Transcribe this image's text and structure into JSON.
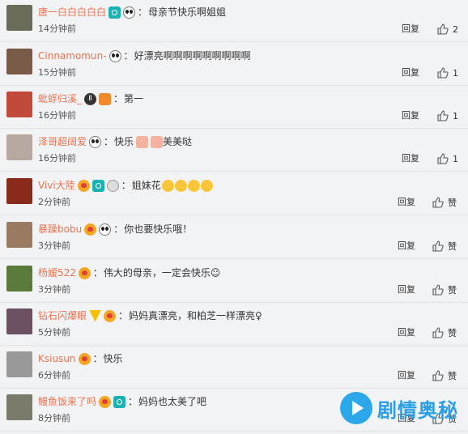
{
  "actions": {
    "reply_label": "回复",
    "like_prefix": "赞"
  },
  "comments": [
    {
      "user": "唐一白白白白白",
      "separator": "：",
      "text": "母亲节快乐啊姐姐",
      "time": "14分钟前",
      "likes": "2",
      "avatar_color": "#6b6b5a",
      "badges": [
        "teal",
        "panda"
      ],
      "emojis": 0
    },
    {
      "user": "Cinnamomun-",
      "separator": "：",
      "text": "好漂亮啊啊啊啊啊啊啊啊啊",
      "time": "15分钟前",
      "likes": "1",
      "avatar_color": "#7a5b4a",
      "badges": [
        "panda"
      ],
      "emojis": 0
    },
    {
      "user": "蚍蜉归溪_",
      "separator": "：",
      "text": "第一",
      "time": "16分钟前",
      "likes": "1",
      "avatar_color": "#c24a3a",
      "badges": [
        "dark",
        "orange"
      ],
      "emojis": 0
    },
    {
      "user": "泽哥超阔爱",
      "separator": "：",
      "text": "快乐",
      "text2": "美美哒",
      "time": "16分钟前",
      "likes": "1",
      "avatar_color": "#b8a9a0",
      "badges": [
        "panda"
      ],
      "emojis": 0,
      "mid_badges": [
        "pink",
        "pink"
      ]
    },
    {
      "user": "Vivi大陸",
      "separator": "：",
      "text": "姐妹花",
      "time": "2分钟前",
      "likes": "赞",
      "avatar_color": "#8a2a1a",
      "badges": [
        "heart",
        "teal",
        "watch"
      ],
      "emojis": 4
    },
    {
      "user": "暴躁bobu",
      "separator": "：",
      "text": "你也要快乐哦！",
      "time": "3分钟前",
      "likes": "赞",
      "avatar_color": "#9a7a60",
      "badges": [
        "heart",
        "panda"
      ],
      "emojis": 0
    },
    {
      "user": "杨嫒522",
      "separator": "：",
      "text": "伟大的母亲，一定会快乐☺",
      "time": "3分钟前",
      "likes": "赞",
      "avatar_color": "#5a7a3a",
      "badges": [
        "heart"
      ],
      "emojis": 0
    },
    {
      "user": "钻石闪爆眼",
      "separator": "：",
      "text": "妈妈真漂亮，和柏芝一样漂亮♀",
      "time": "5分钟前",
      "likes": "赞",
      "avatar_color": "#6a5060",
      "badges": [
        "gold",
        "heart"
      ],
      "emojis": 0
    },
    {
      "user": "Ksiusun",
      "separator": "：",
      "text": "快乐",
      "time": "6分钟前",
      "likes": "赞",
      "avatar_color": "#999999",
      "badges": [
        "heart"
      ],
      "emojis": 0
    },
    {
      "user": "鳗鱼饭来了吗",
      "separator": "：",
      "text": "妈妈也太美了吧",
      "time": "8分钟前",
      "likes": "赞",
      "avatar_color": "#7a7a6a",
      "badges": [
        "heart",
        "teal"
      ],
      "emojis": 0
    }
  ],
  "watermark": {
    "text": "剧情奥秘",
    "icon": "play-circle-icon"
  }
}
